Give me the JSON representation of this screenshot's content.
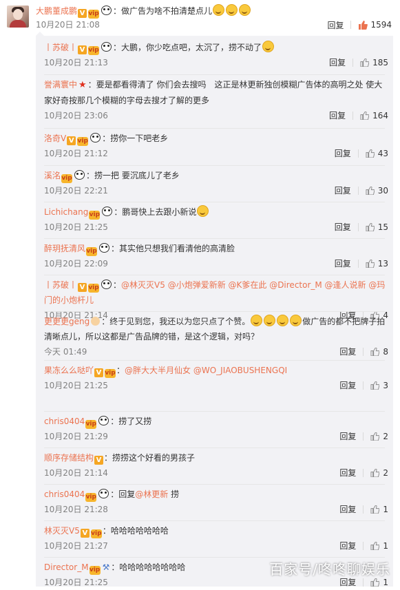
{
  "main_comment": {
    "user": "大鹏董成鹏",
    "text": "：做广告为啥不拍清楚点儿",
    "time": "10月20日 21:08",
    "reply_label": "回复",
    "likes": "1594",
    "like_color": "#eb7350"
  },
  "comments": [
    {
      "user": "丨苏破丨",
      "badges": [
        "v",
        "vip",
        "panda"
      ],
      "text": "：大鹏，你少吃点吧，太沉了，捞不动了",
      "emoji_after": 1,
      "time": "10月20日 21:13",
      "reply_label": "回复",
      "likes": "185"
    },
    {
      "user": "誉满寰中",
      "badges": [
        "star"
      ],
      "text": "：要是都看得清了 你们会去搜吗　这正是林更新独创模糊广告体的高明之处 使大家好奇按那几个模糊的字母去搜才了解的更多",
      "time": "10月20日 23:06",
      "reply_label": "回复",
      "likes": "164"
    },
    {
      "user": "洛奇V",
      "badges": [
        "v",
        "vip",
        "panda"
      ],
      "text": "：捞你一下吧老乡",
      "time": "10月20日 21:12",
      "reply_label": "回复",
      "likes": "43"
    },
    {
      "user": "溪洺",
      "badges": [
        "vip",
        "panda"
      ],
      "text": "：捞一把 要沉底儿了老乡",
      "time": "10月20日 22:21",
      "reply_label": "回复",
      "likes": "30"
    },
    {
      "user": "Lichichang",
      "badges": [
        "vip",
        "panda"
      ],
      "text": "：鹏哥快上去跟小新说",
      "emoji_after": 1,
      "time": "10月20日 21:25",
      "reply_label": "回复",
      "likes": "15"
    },
    {
      "user": "醉玥抚清风",
      "badges": [
        "vip",
        "panda"
      ],
      "text": "：其实他只想我们看清他的高清脸",
      "time": "10月20日 22:09",
      "reply_label": "回复",
      "likes": "13"
    },
    {
      "user": "丨苏破丨",
      "badges": [
        "v",
        "vip",
        "panda"
      ],
      "text_parts": [
        "：",
        "@林灭灭V5 @小炮弹爱新新 @K爹在此 @Director_M @逢人说新 @玛门的小炮杆儿"
      ],
      "time": "10月20日 21:14",
      "reply_label": "回复",
      "likes": "4"
    },
    {
      "user": "更更更geng",
      "badges": [
        "lady"
      ],
      "text": "：终于见到您，我还以为您只点了个赞。",
      "emoji_mid": 4,
      "text2": "做广告的都不把牌子拍清晰点儿，所以这都是广告品牌的错，是这个逻辑，对吗？",
      "time": "今天 01:49",
      "reply_label": "回复",
      "likes": "8"
    },
    {
      "user": "果冻么么哒吖",
      "badges": [
        "v",
        "vip"
      ],
      "text_parts": [
        "：",
        "@胖大大半月仙女 @WO_JIAOBUSHENGQI"
      ],
      "time": "10月20日 21:25",
      "reply_label": "回复",
      "likes": "3"
    },
    {
      "user": "chris0404",
      "badges": [
        "vip",
        "panda"
      ],
      "text": "：捞了又捞",
      "time": "10月20日 21:29",
      "reply_label": "回复",
      "likes": "2"
    },
    {
      "user": "顺序存储结构",
      "badges": [
        "v"
      ],
      "text": "：捞捞这个好看的男孩子",
      "time": "10月20日 21:14",
      "reply_label": "回复",
      "likes": "2"
    },
    {
      "user": "chris0404",
      "badges": [
        "vip",
        "panda"
      ],
      "text_parts": [
        "：回复",
        "@林更新",
        "捞"
      ],
      "time": "10月20日 21:28",
      "reply_label": "回复",
      "likes": "1"
    },
    {
      "user": "林灭灭V5",
      "badges": [
        "v",
        "vip"
      ],
      "text": "：哈哈哈哈哈哈哈",
      "time": "10月20日 21:27",
      "reply_label": "回复",
      "likes": "1"
    },
    {
      "user": "Director_M",
      "badges": [
        "vip",
        "hammer"
      ],
      "text": "：哈哈哈哈哈哈哈哈",
      "time": "10月20日 21:25",
      "reply_label": "回复",
      "likes": "1"
    }
  ],
  "watermark": "百家号/咚咚聊娱乐",
  "icons": {
    "like": "thumbs-up-icon",
    "verified": "v-badge-icon",
    "vip": "vip-badge-icon",
    "panda": "panda-icon"
  },
  "colors": {
    "username": "#eb7350",
    "meta": "#808080",
    "panel": "#f2f2f5"
  }
}
